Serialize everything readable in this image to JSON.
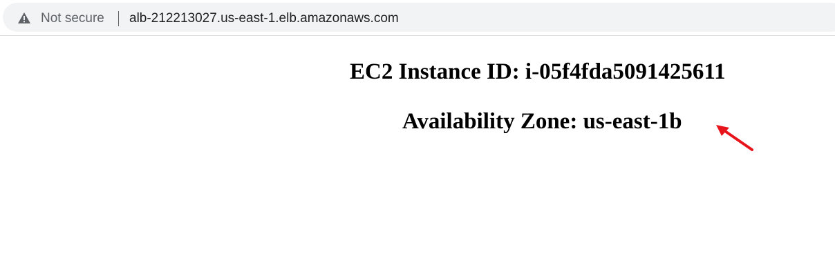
{
  "browser": {
    "security_label": "Not secure",
    "url": "alb-212213027.us-east-1.elb.amazonaws.com",
    "security_icon": "warning-triangle-icon"
  },
  "page": {
    "instance_line": "EC2 Instance ID: i-05f4fda5091425611",
    "zone_line": "Availability Zone: us-east-1b"
  },
  "annotation": {
    "arrow_icon": "red-arrow-icon",
    "arrow_color": "#e8141c"
  },
  "colors": {
    "omnibox_bg": "#f1f3f4",
    "muted_text": "#5f6368",
    "url_text": "#202124"
  }
}
